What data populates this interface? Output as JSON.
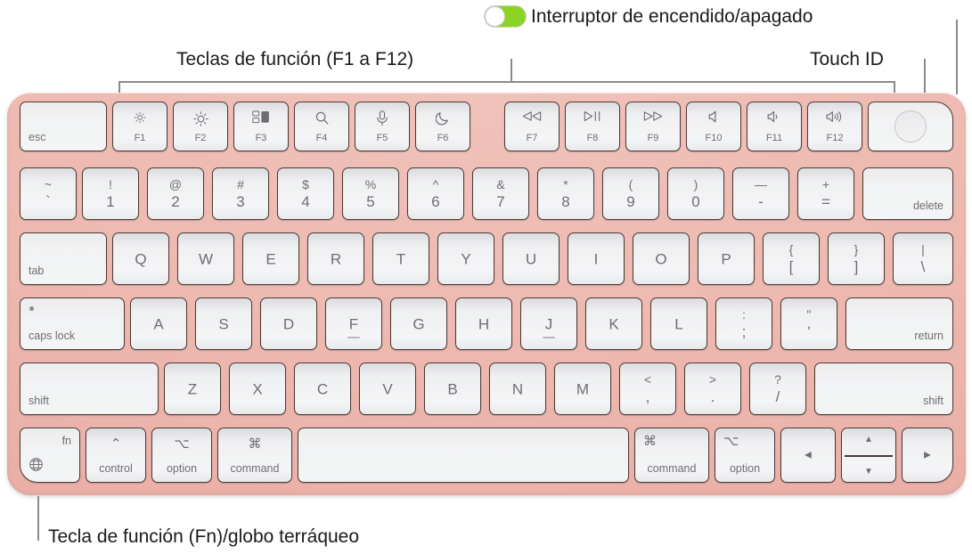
{
  "annotations": {
    "power_switch": "Interruptor de encendido/apagado",
    "function_keys": "Teclas de función (F1 a F12)",
    "touch_id": "Touch ID",
    "fn_globe": "Tecla de función (Fn)/globo terráqueo"
  },
  "colors": {
    "body_pink": "#eeb9b0",
    "key_face": "#f2f3f4",
    "key_border": "#4a3a38",
    "label_gray": "#6e6e72",
    "toggle_green": "#8cd424",
    "leader_line": "#8a8a8a",
    "text_black": "#1a1a1a"
  },
  "toggle": {
    "state": "on",
    "knob_position": "left"
  },
  "keyboard": {
    "layout": "US ANSI — Magic Keyboard with Touch ID",
    "rows": [
      {
        "name": "function-row",
        "keys": [
          {
            "id": "esc",
            "bl": "esc"
          },
          {
            "id": "f1",
            "icon": "brightness-down-icon",
            "fn": "F1"
          },
          {
            "id": "f2",
            "icon": "brightness-up-icon",
            "fn": "F2"
          },
          {
            "id": "f3",
            "icon": "mission-control-icon",
            "fn": "F3"
          },
          {
            "id": "f4",
            "icon": "spotlight-search-icon",
            "fn": "F4"
          },
          {
            "id": "f5",
            "icon": "dictation-mic-icon",
            "fn": "F5"
          },
          {
            "id": "f6",
            "icon": "do-not-disturb-moon-icon",
            "fn": "F6"
          },
          {
            "id": "f7",
            "icon": "rewind-icon",
            "fn": "F7"
          },
          {
            "id": "f8",
            "icon": "play-pause-icon",
            "fn": "F8"
          },
          {
            "id": "f9",
            "icon": "fast-forward-icon",
            "fn": "F9"
          },
          {
            "id": "f10",
            "icon": "mute-icon",
            "fn": "F10"
          },
          {
            "id": "f11",
            "icon": "volume-down-icon",
            "fn": "F11"
          },
          {
            "id": "f12",
            "icon": "volume-up-icon",
            "fn": "F12"
          },
          {
            "id": "touchid",
            "icon": "touch-id-icon"
          }
        ]
      },
      {
        "name": "number-row",
        "keys": [
          {
            "id": "backtick",
            "up": "~",
            "lo": "`"
          },
          {
            "id": "1",
            "up": "!",
            "lo": "1"
          },
          {
            "id": "2",
            "up": "@",
            "lo": "2"
          },
          {
            "id": "3",
            "up": "#",
            "lo": "3"
          },
          {
            "id": "4",
            "up": "$",
            "lo": "4"
          },
          {
            "id": "5",
            "up": "%",
            "lo": "5"
          },
          {
            "id": "6",
            "up": "^",
            "lo": "6"
          },
          {
            "id": "7",
            "up": "&",
            "lo": "7"
          },
          {
            "id": "8",
            "up": "*",
            "lo": "8"
          },
          {
            "id": "9",
            "up": "(",
            "lo": "9"
          },
          {
            "id": "0",
            "up": ")",
            "lo": "0"
          },
          {
            "id": "minus",
            "up": "—",
            "lo": "-"
          },
          {
            "id": "equal",
            "up": "+",
            "lo": "="
          },
          {
            "id": "delete",
            "br": "delete"
          }
        ]
      },
      {
        "name": "qwerty-row",
        "keys": [
          {
            "id": "tab",
            "bl": "tab"
          },
          {
            "id": "q",
            "main": "Q"
          },
          {
            "id": "w",
            "main": "W"
          },
          {
            "id": "e",
            "main": "E"
          },
          {
            "id": "r",
            "main": "R"
          },
          {
            "id": "t",
            "main": "T"
          },
          {
            "id": "y",
            "main": "Y"
          },
          {
            "id": "u",
            "main": "U"
          },
          {
            "id": "i",
            "main": "I"
          },
          {
            "id": "o",
            "main": "O"
          },
          {
            "id": "p",
            "main": "P"
          },
          {
            "id": "bracketleft",
            "up": "{",
            "lo": "["
          },
          {
            "id": "bracketright",
            "up": "}",
            "lo": "]"
          },
          {
            "id": "backslash",
            "up": "|",
            "lo": "\\"
          }
        ]
      },
      {
        "name": "home-row",
        "keys": [
          {
            "id": "capslock",
            "bl": "caps lock",
            "dot": true
          },
          {
            "id": "a",
            "main": "A"
          },
          {
            "id": "s",
            "main": "S"
          },
          {
            "id": "d",
            "main": "D"
          },
          {
            "id": "f",
            "main": "F",
            "homing": true
          },
          {
            "id": "g",
            "main": "G"
          },
          {
            "id": "h",
            "main": "H"
          },
          {
            "id": "j",
            "main": "J",
            "homing": true
          },
          {
            "id": "k",
            "main": "K"
          },
          {
            "id": "l",
            "main": "L"
          },
          {
            "id": "semicolon",
            "up": ":",
            "lo": ";"
          },
          {
            "id": "quote",
            "up": "\"",
            "lo": "'"
          },
          {
            "id": "return",
            "br": "return"
          }
        ]
      },
      {
        "name": "shift-row",
        "keys": [
          {
            "id": "shift-left",
            "bl": "shift"
          },
          {
            "id": "z",
            "main": "Z"
          },
          {
            "id": "x",
            "main": "X"
          },
          {
            "id": "c",
            "main": "C"
          },
          {
            "id": "v",
            "main": "V"
          },
          {
            "id": "b",
            "main": "B"
          },
          {
            "id": "n",
            "main": "N"
          },
          {
            "id": "m",
            "main": "M"
          },
          {
            "id": "comma",
            "up": "<",
            "lo": ","
          },
          {
            "id": "period",
            "up": ">",
            "lo": "."
          },
          {
            "id": "slash",
            "up": "?",
            "lo": "/"
          },
          {
            "id": "shift-right",
            "br": "shift"
          }
        ]
      },
      {
        "name": "bottom-row",
        "keys": [
          {
            "id": "fn",
            "tr": "fn",
            "icon": "globe-icon"
          },
          {
            "id": "control-left",
            "sym": "⌃",
            "word": "control"
          },
          {
            "id": "option-left",
            "sym": "⌥",
            "word": "option"
          },
          {
            "id": "command-left",
            "sym": "⌘",
            "word": "command"
          },
          {
            "id": "space"
          },
          {
            "id": "command-right",
            "tlsym": "⌘",
            "word": "command"
          },
          {
            "id": "option-right",
            "tlsym": "⌥",
            "word": "option"
          },
          {
            "id": "arrow-left",
            "arrow": "◀"
          },
          {
            "id": "arrow-updown",
            "arrow_up": "▲",
            "arrow_down": "▼"
          },
          {
            "id": "arrow-right",
            "arrow": "▶"
          }
        ]
      }
    ]
  }
}
